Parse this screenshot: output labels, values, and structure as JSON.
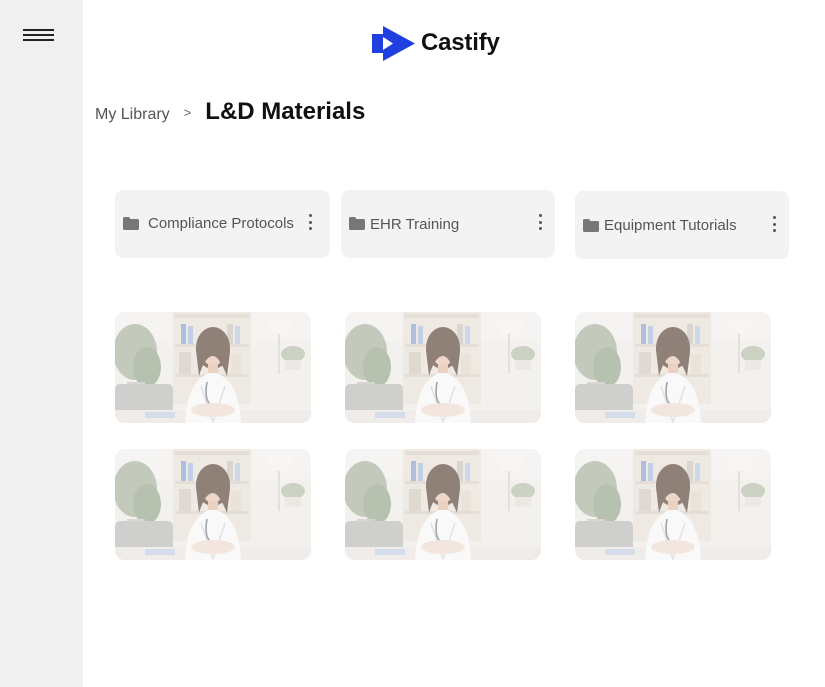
{
  "sidebar": {
    "menu_icon": "hamburger-menu-icon"
  },
  "header": {
    "logo_text": "Castify",
    "logo_icon": "castify-play-mark-icon",
    "brand_color": "#1f3fe0"
  },
  "breadcrumb": {
    "parent": "My Library",
    "separator": ">",
    "current": "L&D Materials"
  },
  "folders": [
    {
      "name": "Compliance Protocols",
      "icon": "folder-icon",
      "menu_icon": "kebab-menu-icon"
    },
    {
      "name": "EHR Training",
      "icon": "folder-icon",
      "menu_icon": "kebab-menu-icon"
    },
    {
      "name": "Equipment Tutorials",
      "icon": "folder-icon",
      "menu_icon": "kebab-menu-icon"
    }
  ],
  "videos": [
    {
      "thumbnail": "doctor-portrait-thumbnail"
    },
    {
      "thumbnail": "doctor-portrait-thumbnail"
    },
    {
      "thumbnail": "doctor-portrait-thumbnail"
    },
    {
      "thumbnail": "doctor-portrait-thumbnail"
    },
    {
      "thumbnail": "doctor-portrait-thumbnail"
    },
    {
      "thumbnail": "doctor-portrait-thumbnail"
    }
  ]
}
